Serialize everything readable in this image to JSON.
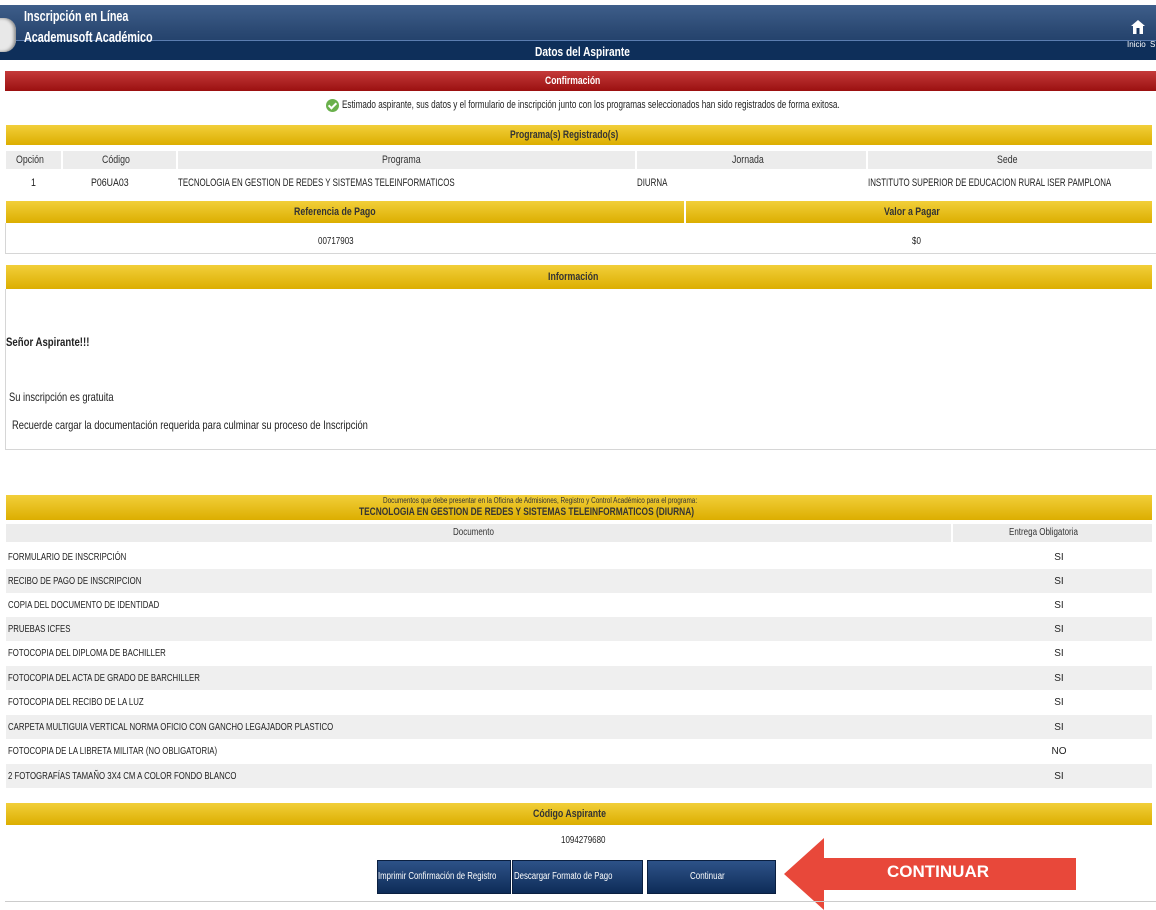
{
  "header": {
    "app_title": "Inscripción en Línea",
    "app_subtitle": "Academusoft Académico",
    "page_title": "Datos del Aspirante",
    "home_label": "Inicio",
    "home_extra": "S"
  },
  "confirmation": {
    "title": "Confirmación",
    "message": "Estimado aspirante, sus datos y el formulario de inscripción junto con los programas seleccionados han sido registrados de forma exitosa."
  },
  "programs": {
    "title": "Programa(s) Registrado(s)",
    "columns": [
      "Opción",
      "Código",
      "Programa",
      "Jornada",
      "Sede"
    ],
    "rows": [
      {
        "opcion": "1",
        "codigo": "P06UA03",
        "programa": "TECNOLOGIA EN GESTION DE REDES Y SISTEMAS TELEINFORMATICOS",
        "jornada": "DIURNA",
        "sede": "INSTITUTO SUPERIOR DE EDUCACION RURAL ISER PAMPLONA"
      }
    ]
  },
  "payment": {
    "ref_label": "Referencia de Pago",
    "value_label": "Valor a Pagar",
    "ref_value": "00717903",
    "amount": "$0"
  },
  "info": {
    "title": "Información",
    "greeting": "Señor Aspirante!!!",
    "line1": "Su inscripción es gratuita",
    "line2": "Recuerde cargar la documentación requerida para culminar su proceso de Inscripción"
  },
  "documents": {
    "header_line1": "Documentos que debe presentar en la Oficina de Admisiones, Registro y Control Académico para el programa:",
    "header_line2": "TECNOLOGIA EN GESTION DE REDES Y SISTEMAS TELEINFORMATICOS (DIURNA)",
    "col_doc": "Documento",
    "col_req": "Entrega Obligatoria",
    "rows": [
      {
        "name": "FORMULARIO DE INSCRIPCIÓN",
        "required": "SI"
      },
      {
        "name": "RECIBO DE PAGO DE INSCRIPCION",
        "required": "SI"
      },
      {
        "name": "COPIA DEL DOCUMENTO DE IDENTIDAD",
        "required": "SI"
      },
      {
        "name": "PRUEBAS ICFES",
        "required": "SI"
      },
      {
        "name": "FOTOCOPIA DEL DIPLOMA DE BACHILLER",
        "required": "SI"
      },
      {
        "name": "FOTOCOPIA DEL ACTA DE GRADO DE BARCHILLER",
        "required": "SI"
      },
      {
        "name": "FOTOCOPIA DEL RECIBO DE LA LUZ",
        "required": "SI"
      },
      {
        "name": "CARPETA MULTIGUIA VERTICAL NORMA OFICIO CON GANCHO LEGAJADOR PLASTICO",
        "required": "SI"
      },
      {
        "name": "FOTOCOPIA DE LA LIBRETA MILITAR (NO OBLIGATORIA)",
        "required": "NO"
      },
      {
        "name": "2 FOTOGRAFÍAS TAMAÑO 3X4 CM A COLOR FONDO BLANCO",
        "required": "SI"
      }
    ]
  },
  "aspirant": {
    "title": "Código Aspirante",
    "code": "1094279680"
  },
  "actions": {
    "print_label": "Imprimir Confirmación de Registro",
    "download_label": "Descargar Formato de Pago",
    "continue_label": "Continuar",
    "callout": "CONTINUAR"
  },
  "colors": {
    "navy": "#183660",
    "gold": "#dcae00",
    "confirm_red": "#9b1010",
    "arrow_red": "#e8483a"
  }
}
